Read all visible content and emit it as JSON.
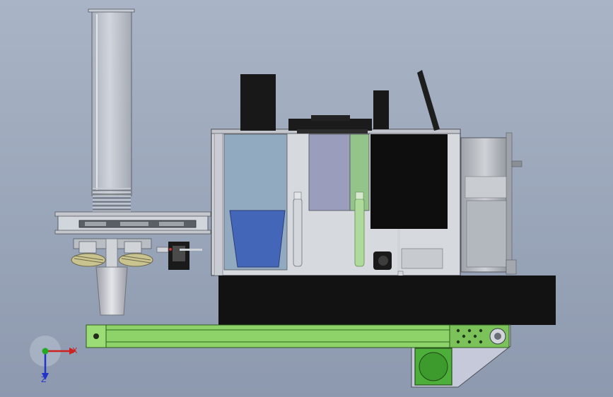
{
  "view": {
    "background_top": "#a9b4c6",
    "background_bottom": "#8d99ae"
  },
  "colors": {
    "frame": "#dadde2",
    "frame_edge": "#55595f",
    "black_part": "#101010",
    "dark_part": "#2b2b2b",
    "green_rail": "#8ed36a",
    "green_dark": "#3f7f2a",
    "blue_liquid": "#4466b8",
    "glass_blue": "#8aa4bc",
    "glass_purple": "#9a9ebc",
    "glass_green": "#94c48a",
    "cylinder": "#c8ccd4",
    "steel": "#b8bcc4",
    "motor": "#b0b4ba",
    "axis_x": "#cc2222",
    "axis_y": "#22aa22",
    "axis_z": "#2233cc"
  },
  "triad": {
    "x_label": "X",
    "z_label": "Z"
  }
}
